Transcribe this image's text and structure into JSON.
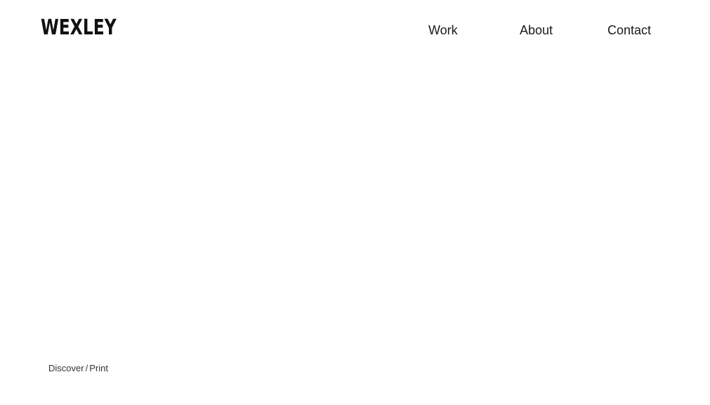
{
  "header": {
    "logo_text": "WEXLEY",
    "nav": {
      "work": "Work",
      "about": "About",
      "contact": "Contact"
    }
  },
  "breadcrumb": {
    "first": "Discover",
    "separator": "/",
    "second": "Print"
  }
}
